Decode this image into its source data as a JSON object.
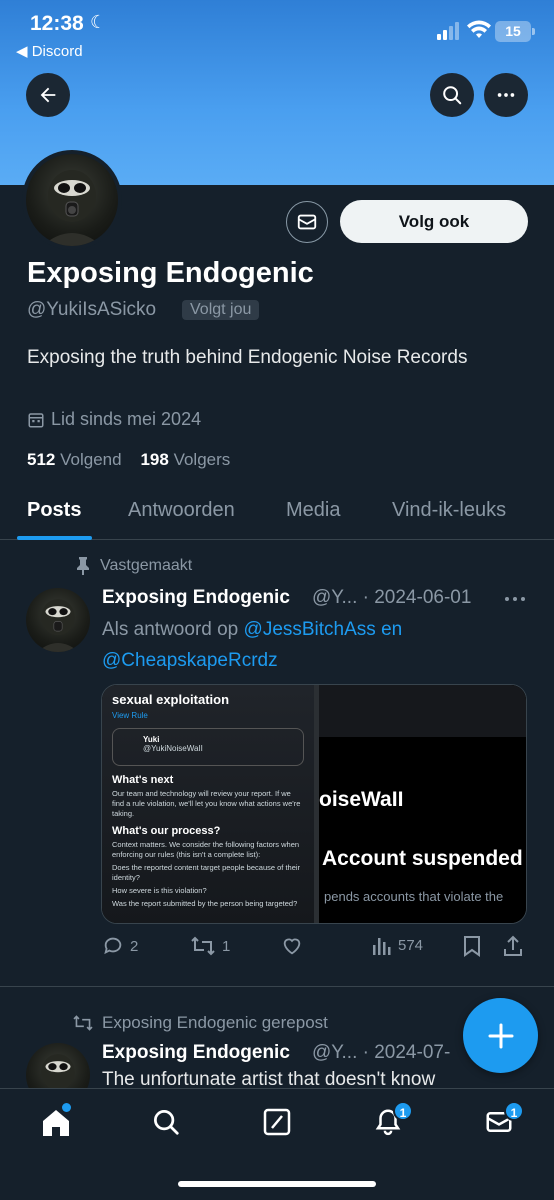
{
  "status_bar": {
    "time": "12:38",
    "back_app": "◀ Discord",
    "battery": "15"
  },
  "profile": {
    "name": "Exposing Endogenic",
    "handle": "@YukiIsASicko",
    "follows_you": "Volgt jou",
    "follow_button": "Volg ook",
    "bio": "Exposing the truth behind Endogenic Noise Records",
    "joined": "Lid sinds mei 2024",
    "following_count": "512",
    "following_label": "Volgend",
    "followers_count": "198",
    "followers_label": "Volgers"
  },
  "tabs": [
    {
      "label": "Posts",
      "active": true
    },
    {
      "label": "Antwoorden",
      "active": false
    },
    {
      "label": "Media",
      "active": false
    },
    {
      "label": "Vind-ik-leuks",
      "active": false
    }
  ],
  "post1": {
    "pinned_label": "Vastgemaakt",
    "name": "Exposing Endogenic",
    "handle_date": "@Y... · 2024-06-01",
    "reply_prefix": "Als antwoord op ",
    "reply_users": "@JessBitchAss en @CheapskapeRcrdz",
    "media_left": {
      "heading": "sexual exploitation",
      "view_rule": "View Rule",
      "card_name": "Yuki",
      "card_handle": "@YukiNoiseWaII",
      "whats_next": "What's next",
      "whats_next_text": "Our team and technology will review your report. If we find a rule violation, we'll let you know what actions we're taking.",
      "process": "What's our process?",
      "process_text": "Context matters. We consider the following factors when enforcing our rules (this isn't a complete list):",
      "q1": "Does the reported content target people because of their identity?",
      "q2": "How severe is this violation?",
      "q3": "Was the report submitted by the person being targeted?"
    },
    "media_right": {
      "name_fragment": "oiseWaII",
      "suspended": "Account suspended",
      "sub": "pends accounts that violate the"
    },
    "replies": "2",
    "reposts": "1",
    "views": "574"
  },
  "post2": {
    "reposted_label": "Exposing Endogenic gerepost",
    "name": "Exposing Endogenic",
    "handle_date": "@Y... · 2024-07-",
    "text": "The unfortunate artist that doesn't know"
  },
  "nav": {
    "notifications_badge": "1",
    "messages_badge": "1"
  },
  "colors": {
    "accent": "#1d9bf0",
    "background": "#15202b",
    "banner": "#4a9ff0"
  }
}
